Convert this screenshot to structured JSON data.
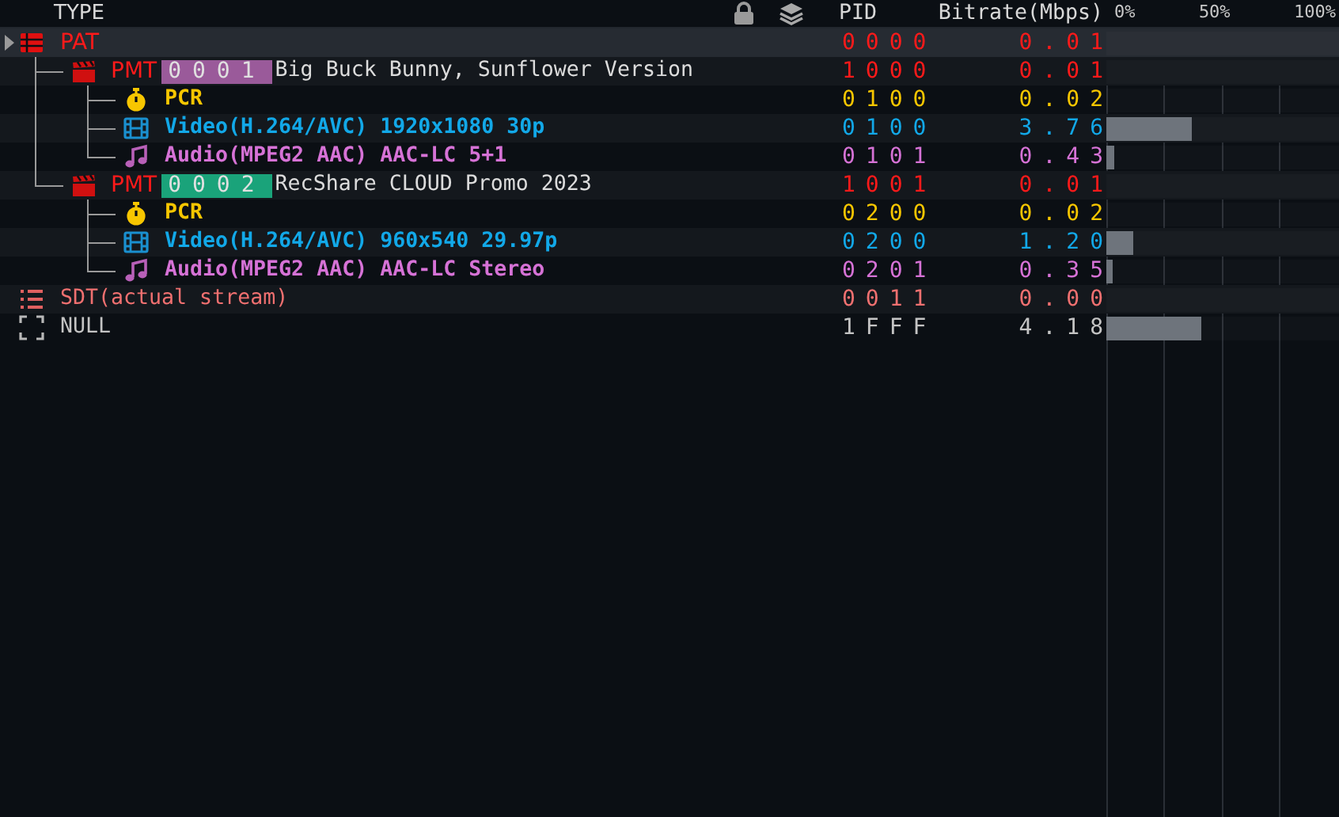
{
  "columns": {
    "type": "TYPE",
    "pid": "PID",
    "bitrate": "Bitrate(Mbps)",
    "scale": [
      "0%",
      "50%",
      "100%"
    ]
  },
  "rows": [
    {
      "kind": "pat",
      "label": "PAT",
      "pid": "0000",
      "bitrate": "0.01",
      "selected": true,
      "toggle": true,
      "children": [
        {
          "kind": "pmt",
          "label": "PMT",
          "program": {
            "number": "0001",
            "color": "#9a5a9a"
          },
          "name": "Big Buck Bunny, Sunflower Version",
          "pid": "1000",
          "bitrate": "0.01",
          "selected": false,
          "children": [
            {
              "kind": "pcr",
              "label": "PCR",
              "pid": "0100",
              "bitrate": "0.02",
              "selected": false
            },
            {
              "kind": "video",
              "label": "Video(H.264/AVC) 1920x1080 30p",
              "pid": "0100",
              "bitrate": "3.76",
              "level": 0.37,
              "selected": false
            },
            {
              "kind": "audio",
              "label": "Audio(MPEG2 AAC) AAC-LC 5+1",
              "pid": "0101",
              "bitrate": "0.43",
              "level": 0.035,
              "selected": false
            }
          ]
        },
        {
          "kind": "pmt",
          "label": "PMT",
          "program": {
            "number": "0002",
            "color": "#1aa37a"
          },
          "name": "RecShare CLOUD Promo 2023",
          "pid": "1001",
          "bitrate": "0.01",
          "selected": false,
          "children": [
            {
              "kind": "pcr",
              "label": "PCR",
              "pid": "0200",
              "bitrate": "0.02",
              "selected": false
            },
            {
              "kind": "video",
              "label": "Video(H.264/AVC) 960x540 29.97p",
              "pid": "0200",
              "bitrate": "1.20",
              "level": 0.115,
              "selected": false
            },
            {
              "kind": "audio",
              "label": "Audio(MPEG2 AAC) AAC-LC Stereo",
              "pid": "0201",
              "bitrate": "0.35",
              "level": 0.03,
              "selected": false
            }
          ]
        }
      ]
    },
    {
      "kind": "sdt",
      "label": "SDT(actual stream)",
      "pid": "0011",
      "bitrate": "0.00",
      "selected": false
    },
    {
      "kind": "null",
      "label": "NULL",
      "pid": "1FFF",
      "bitrate": "4.18",
      "level": 0.41,
      "selected": false
    }
  ]
}
